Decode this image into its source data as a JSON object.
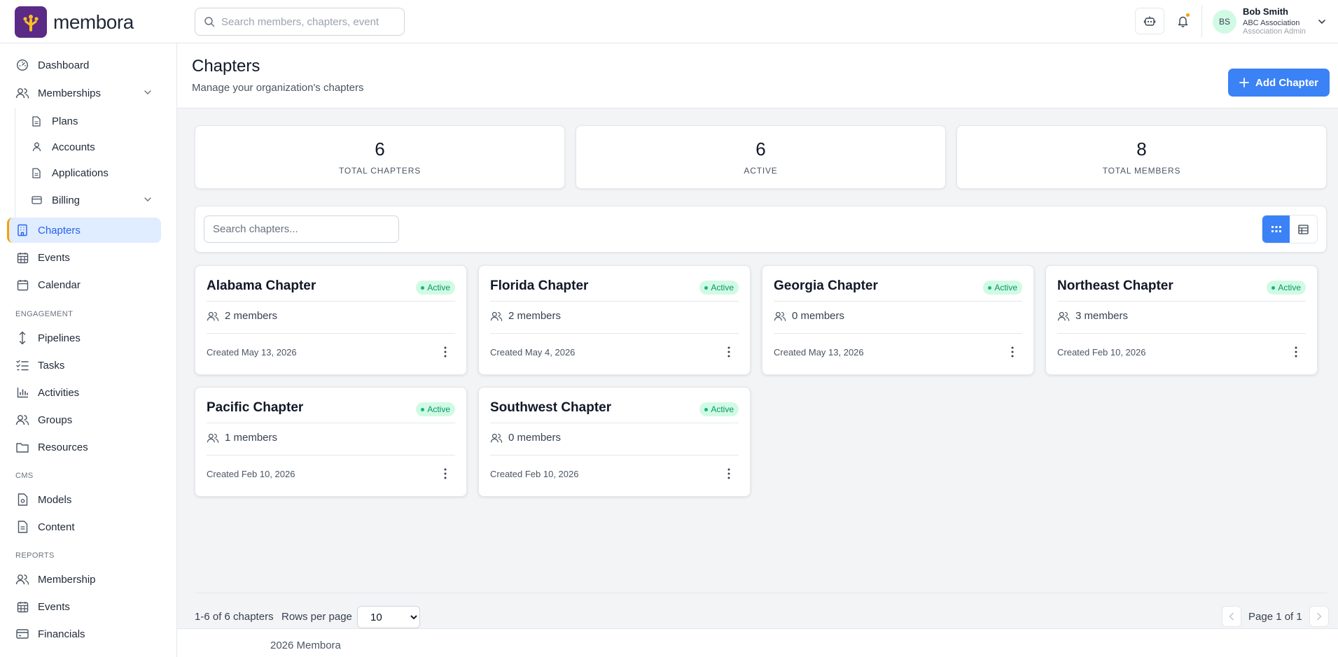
{
  "app": {
    "name": "membora"
  },
  "search": {
    "placeholder": "Search members, chapters, events..."
  },
  "user": {
    "initials": "BS",
    "name": "Bob Smith",
    "org": "ABC Association",
    "role": "Association Admin"
  },
  "sidebar": {
    "items": [
      {
        "label": "Dashboard",
        "icon": "dashboard-icon"
      },
      {
        "label": "Memberships",
        "icon": "users-icon"
      },
      {
        "label": "Plans",
        "icon": "file-icon"
      },
      {
        "label": "Accounts",
        "icon": "user-icon"
      },
      {
        "label": "Applications",
        "icon": "file-icon"
      },
      {
        "label": "Billing",
        "icon": "credit-card-icon"
      },
      {
        "label": "Chapters",
        "icon": "building-icon"
      },
      {
        "label": "Events",
        "icon": "calendar-grid-icon"
      },
      {
        "label": "Calendar",
        "icon": "calendar-icon"
      },
      {
        "label": "Pipelines",
        "icon": "arrows-vertical-icon"
      },
      {
        "label": "Tasks",
        "icon": "list-check-icon"
      },
      {
        "label": "Activities",
        "icon": "bar-chart-icon"
      },
      {
        "label": "Groups",
        "icon": "users-icon"
      },
      {
        "label": "Resources",
        "icon": "folder-icon"
      },
      {
        "label": "Models",
        "icon": "file-settings-icon"
      },
      {
        "label": "Content",
        "icon": "file-text-icon"
      },
      {
        "label": "Membership",
        "icon": "users-icon"
      },
      {
        "label": "Events",
        "icon": "calendar-grid-icon"
      },
      {
        "label": "Financials",
        "icon": "credit-card-icon"
      }
    ],
    "sections": [
      "ENGAGEMENT",
      "CMS",
      "REPORTS"
    ]
  },
  "header": {
    "title": "Chapters",
    "subtitle": "Manage your organization's chapters",
    "add_label": "Add Chapter"
  },
  "stats": [
    {
      "value": "6",
      "label": "TOTAL CHAPTERS"
    },
    {
      "value": "6",
      "label": "ACTIVE"
    },
    {
      "value": "8",
      "label": "TOTAL MEMBERS"
    }
  ],
  "toolbar": {
    "search_placeholder": "Search chapters..."
  },
  "chapters": [
    {
      "name": "Alabama Chapter",
      "status": "Active",
      "members": "2 members",
      "created": "Created May 13, 2026"
    },
    {
      "name": "Florida Chapter",
      "status": "Active",
      "members": "2 members",
      "created": "Created May 4, 2026"
    },
    {
      "name": "Georgia Chapter",
      "status": "Active",
      "members": "0 members",
      "created": "Created May 13, 2026"
    },
    {
      "name": "Northeast Chapter",
      "status": "Active",
      "members": "3 members",
      "created": "Created Feb 10, 2026"
    },
    {
      "name": "Pacific Chapter",
      "status": "Active",
      "members": "1 members",
      "created": "Created Feb 10, 2026"
    },
    {
      "name": "Southwest Chapter",
      "status": "Active",
      "members": "0 members",
      "created": "Created Feb 10, 2026"
    }
  ],
  "pagination": {
    "range": "1-6 of 6 chapters",
    "rows_label": "Rows per page",
    "rows_value": "10",
    "page_text": "Page 1 of 1"
  },
  "footer": {
    "copyright": "2026 Membora"
  },
  "colors": {
    "brand": "#5b2a86",
    "accent": "#3b82f6",
    "active_nav_bg": "#e0ecff",
    "status_active": "#059669"
  }
}
